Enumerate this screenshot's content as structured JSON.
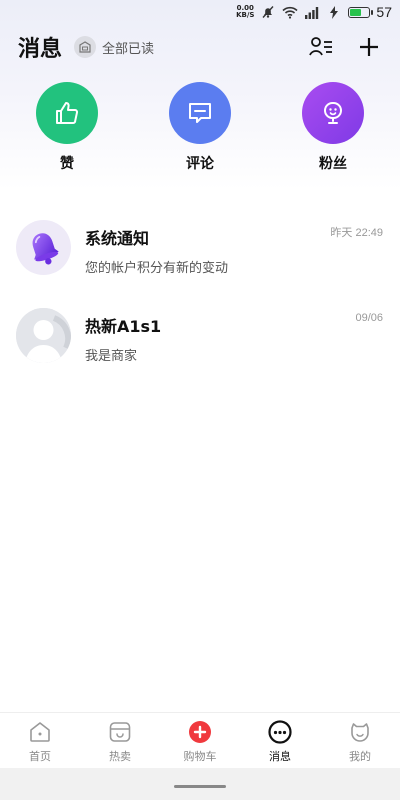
{
  "status_bar": {
    "net_speed_value": "0.00",
    "net_speed_unit": "KB/S",
    "battery_level": "57"
  },
  "header": {
    "title": "消息",
    "mark_all_read": "全部已读"
  },
  "quick_actions": [
    {
      "label": "赞",
      "icon": "thumbs-up-icon",
      "color": "#22c27e"
    },
    {
      "label": "评论",
      "icon": "comment-bubble-icon",
      "color": "#5b7df0"
    },
    {
      "label": "粉丝",
      "icon": "fans-smiley-icon",
      "color": "#8f42ea"
    }
  ],
  "messages": [
    {
      "title": "系统通知",
      "preview": "您的帐户积分有新的变动",
      "time": "昨天 22:49",
      "avatar": "bell-icon"
    },
    {
      "title": "热新A1s1",
      "preview": "我是商家",
      "time": "09/06",
      "avatar": "default-user-avatar"
    }
  ],
  "tabbar": [
    {
      "label": "首页",
      "icon": "home-icon",
      "active": false
    },
    {
      "label": "热卖",
      "icon": "hot-sale-icon",
      "active": false
    },
    {
      "label": "购物车",
      "icon": "cart-plus-icon",
      "active": false
    },
    {
      "label": "消息",
      "icon": "message-icon",
      "active": true
    },
    {
      "label": "我的",
      "icon": "profile-icon",
      "active": false
    }
  ]
}
